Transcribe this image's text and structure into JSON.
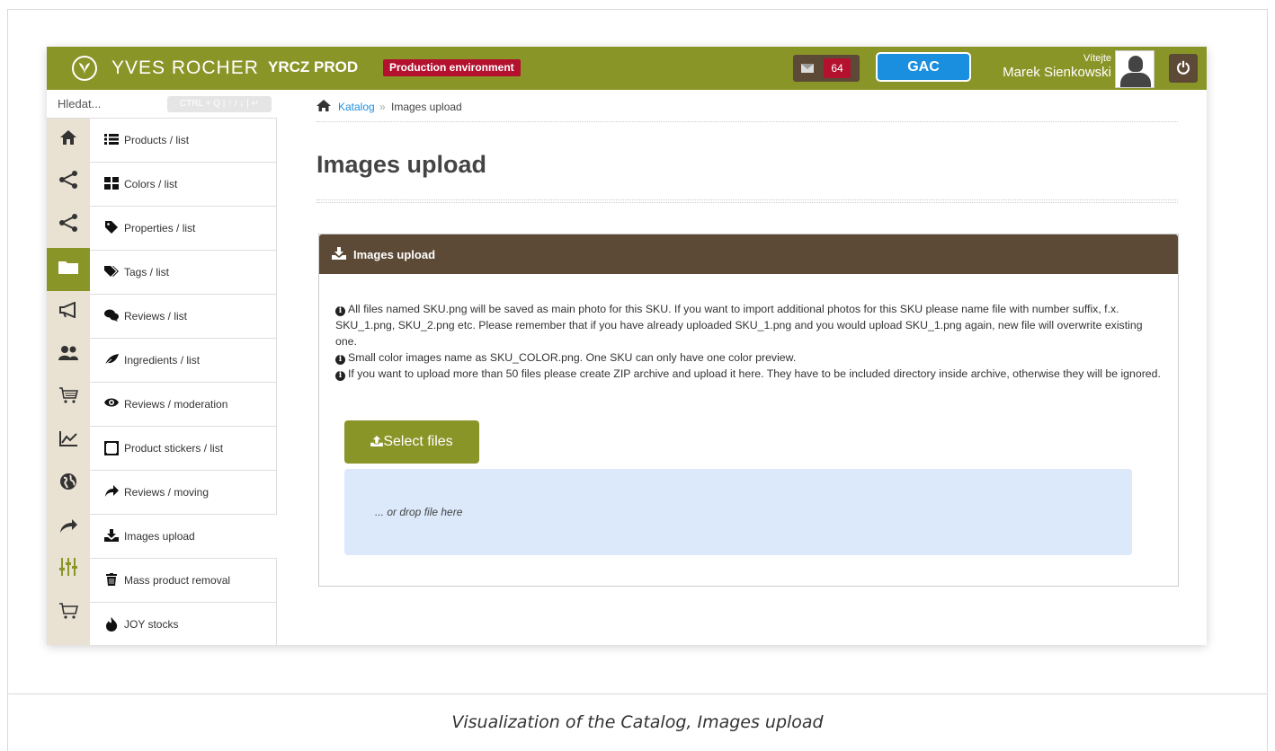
{
  "header": {
    "brand": "YVES ROCHER",
    "env_name": "YRCZ PROD",
    "env_badge": "Production environment",
    "mail_count": "64",
    "gac_label": "GAC",
    "welcome": "Vítejte",
    "user_name": "Marek Sienkowski",
    "power_icon": "power-icon",
    "accent_color": "#8a9528",
    "dark_color": "#5c4a36",
    "badge_color": "#b3112e",
    "gac_color": "#1a8fe0"
  },
  "search": {
    "placeholder": "Hledat...",
    "shortcut": "CTRL + Q | ↑ / ↓ | ↵"
  },
  "rail": [
    {
      "icon": "home-icon",
      "glyph": "🏠"
    },
    {
      "icon": "share-icon",
      "glyph": "⋖"
    },
    {
      "icon": "share-icon",
      "glyph": "⋖"
    },
    {
      "icon": "folder-icon",
      "glyph": "▭"
    },
    {
      "icon": "megaphone-icon",
      "glyph": "⊲"
    },
    {
      "icon": "users-icon",
      "glyph": "👥"
    },
    {
      "icon": "cart-icon",
      "glyph": "🛒"
    },
    {
      "icon": "chart-icon",
      "glyph": "⟋"
    },
    {
      "icon": "globe-icon",
      "glyph": "◍"
    },
    {
      "icon": "forward-icon",
      "glyph": "➦"
    },
    {
      "icon": "sliders-icon",
      "glyph": "⫶"
    },
    {
      "icon": "cart-icon",
      "glyph": "🛒"
    }
  ],
  "submenu": [
    {
      "label": "Products / list",
      "icon": "list-icon",
      "glyph": "☰"
    },
    {
      "label": "Colors / list",
      "icon": "grid-icon",
      "glyph": "▦"
    },
    {
      "label": "Properties / list",
      "icon": "tag-icon",
      "glyph": "◆"
    },
    {
      "label": "Tags / list",
      "icon": "tags-icon",
      "glyph": "◆"
    },
    {
      "label": "Reviews / list",
      "icon": "comments-icon",
      "glyph": "●"
    },
    {
      "label": "Ingredients / list",
      "icon": "leaf-icon",
      "glyph": "❦"
    },
    {
      "label": "Reviews / moderation",
      "icon": "eye-icon",
      "glyph": "◉"
    },
    {
      "label": "Product stickers / list",
      "icon": "frame-icon",
      "glyph": "▢"
    },
    {
      "label": "Reviews / moving",
      "icon": "share-arrow-icon",
      "glyph": "➦"
    },
    {
      "label": "Images upload",
      "icon": "upload-icon",
      "glyph": "⤓"
    },
    {
      "label": "Mass product removal",
      "icon": "trash-icon",
      "glyph": "▮"
    },
    {
      "label": "JOY stocks",
      "icon": "fire-icon",
      "glyph": "▲"
    }
  ],
  "breadcrumb": {
    "home_icon": "home-icon",
    "link": "Katalog",
    "separator": "»",
    "current": "Images upload"
  },
  "page": {
    "title": "Images upload"
  },
  "panel": {
    "title": "Images upload",
    "info_1": "All files named SKU.png will be saved as main photo for this SKU. If you want to import additional photos for this SKU please name file with number suffix, f.x. SKU_1.png, SKU_2.png etc. Please remember that if you have already uploaded SKU_1.png and you would upload SKU_1.png again, new file will overwrite existing one.",
    "info_2": "Small color images name as SKU_COLOR.png. One SKU can only have one color preview.",
    "info_3": "If you want to upload more than 50 files please create ZIP archive and upload it here. They have to be included directory inside archive, otherwise they will be ignored.",
    "select_label": "Select files",
    "drop_label": "... or drop file here"
  },
  "caption": "Visualization of the Catalog, Images upload"
}
